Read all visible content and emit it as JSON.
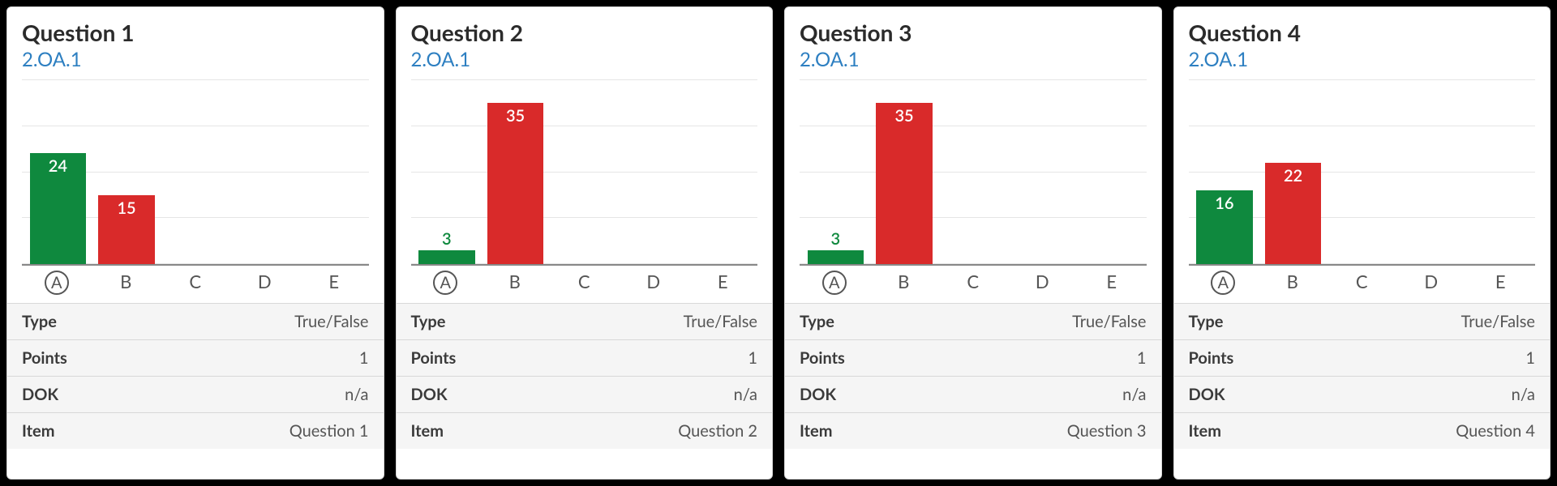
{
  "colors": {
    "correct": "#0f893e",
    "incorrect": "#d92a2a",
    "link": "#2d7fc1"
  },
  "meta_labels": {
    "type": "Type",
    "points": "Points",
    "dok": "DOK",
    "item": "Item"
  },
  "chart_data": [
    {
      "type": "bar",
      "title": "Question 1",
      "subtitle": "2.OA.1",
      "categories": [
        "A",
        "B",
        "C",
        "D",
        "E"
      ],
      "values": [
        24,
        15,
        0,
        0,
        0
      ],
      "colors": [
        "green",
        "red",
        "red",
        "red",
        "red"
      ],
      "correct_category": "A",
      "ylim": [
        0,
        40
      ],
      "gridline_count": 5,
      "meta": {
        "type": "True/False",
        "points": "1",
        "dok": "n/a",
        "item": "Question 1"
      }
    },
    {
      "type": "bar",
      "title": "Question 2",
      "subtitle": "2.OA.1",
      "categories": [
        "A",
        "B",
        "C",
        "D",
        "E"
      ],
      "values": [
        3,
        35,
        0,
        0,
        0
      ],
      "colors": [
        "green",
        "red",
        "red",
        "red",
        "red"
      ],
      "correct_category": "A",
      "ylim": [
        0,
        40
      ],
      "gridline_count": 5,
      "meta": {
        "type": "True/False",
        "points": "1",
        "dok": "n/a",
        "item": "Question 2"
      }
    },
    {
      "type": "bar",
      "title": "Question 3",
      "subtitle": "2.OA.1",
      "categories": [
        "A",
        "B",
        "C",
        "D",
        "E"
      ],
      "values": [
        3,
        35,
        0,
        0,
        0
      ],
      "colors": [
        "green",
        "red",
        "red",
        "red",
        "red"
      ],
      "correct_category": "A",
      "ylim": [
        0,
        40
      ],
      "gridline_count": 5,
      "meta": {
        "type": "True/False",
        "points": "1",
        "dok": "n/a",
        "item": "Question 3"
      }
    },
    {
      "type": "bar",
      "title": "Question 4",
      "subtitle": "2.OA.1",
      "categories": [
        "A",
        "B",
        "C",
        "D",
        "E"
      ],
      "values": [
        16,
        22,
        0,
        0,
        0
      ],
      "colors": [
        "green",
        "red",
        "red",
        "red",
        "red"
      ],
      "correct_category": "A",
      "ylim": [
        0,
        40
      ],
      "gridline_count": 5,
      "meta": {
        "type": "True/False",
        "points": "1",
        "dok": "n/a",
        "item": "Question 4"
      }
    }
  ]
}
